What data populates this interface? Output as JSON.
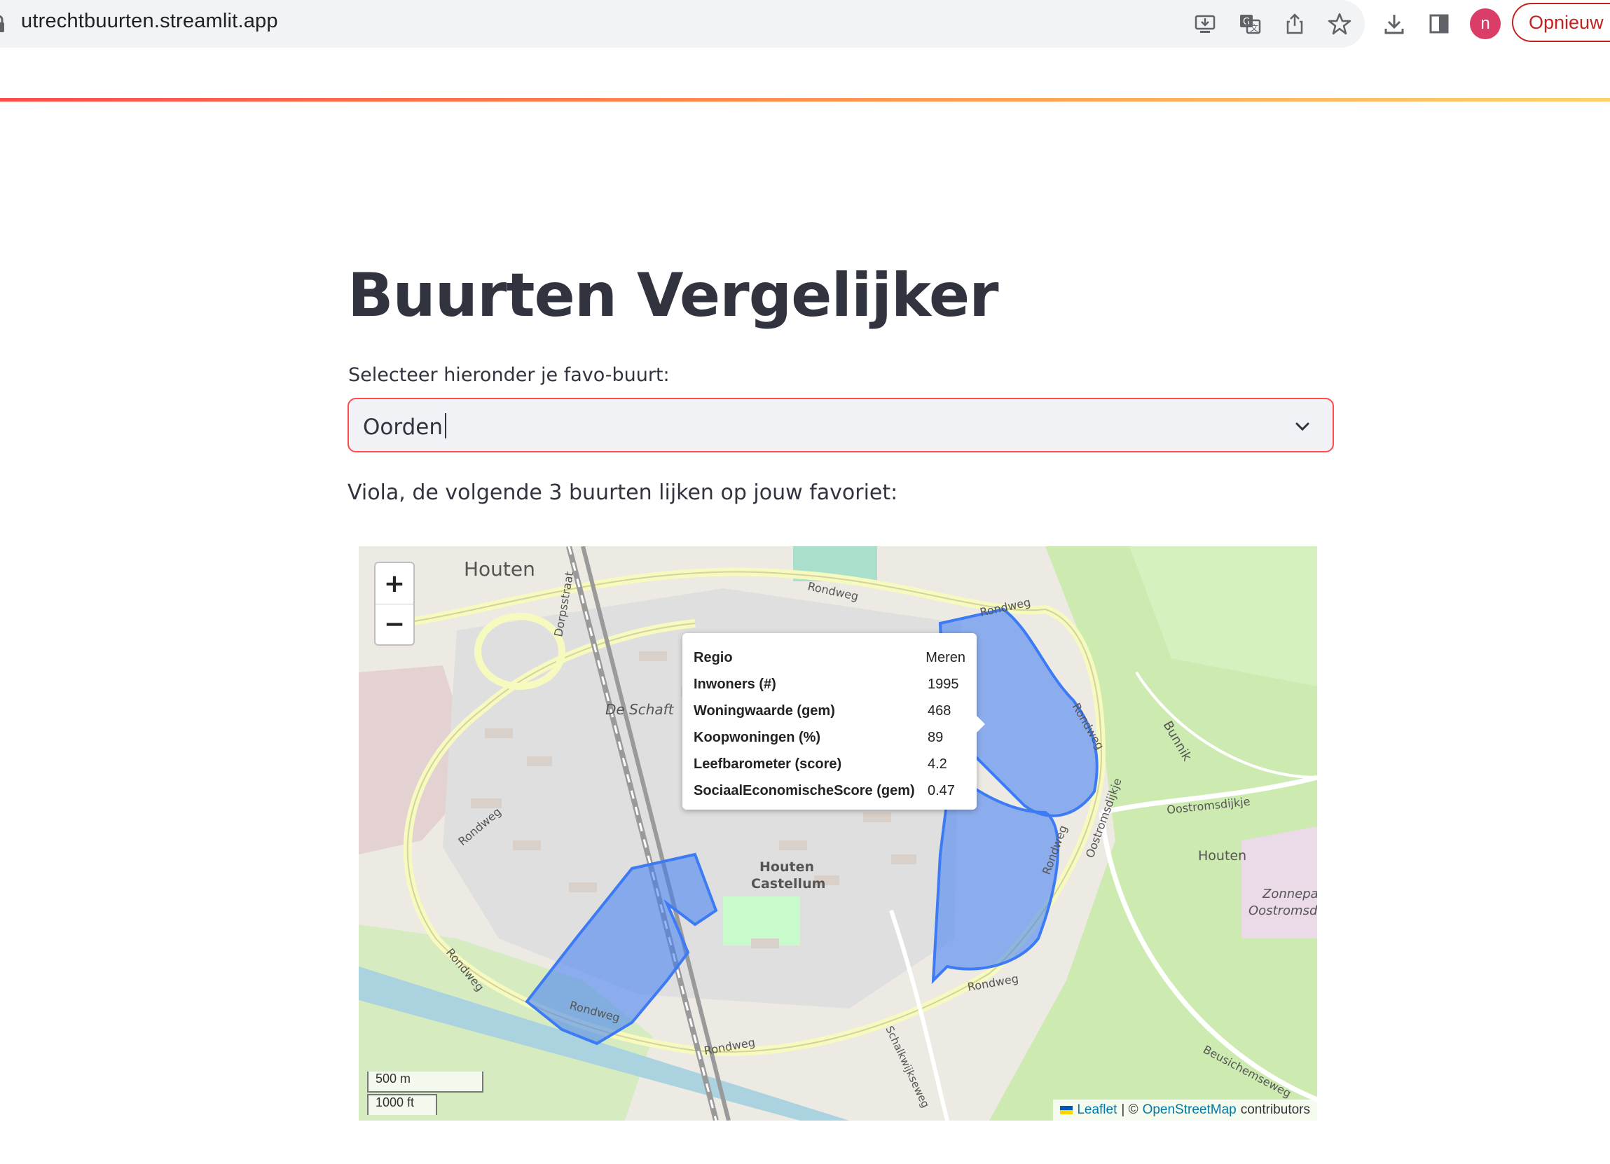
{
  "browser": {
    "url": "utrechtbuurten.streamlit.app",
    "avatar_initial": "n",
    "restart_label": "Opnieuw",
    "icons": [
      "install-app-icon",
      "translate-icon",
      "share-icon",
      "bookmark-star-icon",
      "download-icon",
      "side-panel-icon"
    ]
  },
  "app": {
    "title": "Buurten Vergelijker",
    "select_label": "Selecteer hieronder je favo-buurt:",
    "select_value": "Oorden",
    "result_text": "Viola, de volgende 3 buurten lijken op jouw favoriet:"
  },
  "map": {
    "zoom_in": "+",
    "zoom_out": "−",
    "highlight_color": "#3d7bf5",
    "place_labels": {
      "houten": "Houten",
      "de_schaft": "De Schaft",
      "castellum_1": "Houten",
      "castellum_2": "Castellum",
      "houten_east": "Houten",
      "zonnepark_1": "Zonnepa",
      "zonnepark_2": "Oostromsd",
      "bunnik": "Bunnik"
    },
    "road_labels": {
      "rondweg_top": "Rondweg",
      "rondweg_left": "Rondweg",
      "rondweg_bottom_left": "Rondweg",
      "rondweg_bottom_1": "Rondweg",
      "rondweg_bottom_2": "Rondweg",
      "rondweg_bottom_3": "Rondweg",
      "rondweg_east_1": "Rondweg",
      "rondweg_east_2": "Rondweg",
      "rondweg_east_3": "Rondweg",
      "dorpsstraat": "Dorpsstraat",
      "oostromsdijkje_1": "Oostromsdijkje",
      "oostromsdijkje_2": "Oostromsdijkje",
      "beusichemseweg": "Beusichemseweg",
      "schalkwijkseweg": "Schalkwijkseweg"
    },
    "tooltip": [
      {
        "key": "Regio",
        "value": "Meren"
      },
      {
        "key": "Inwoners (#)",
        "value": "1995"
      },
      {
        "key": "Woningwaarde (gem)",
        "value": "468"
      },
      {
        "key": "Koopwoningen (%)",
        "value": "89"
      },
      {
        "key": "Leefbarometer (score)",
        "value": "4.2"
      },
      {
        "key": "SociaalEconomischeScore (gem)",
        "value": "0.47"
      }
    ],
    "scale_metric": "500 m",
    "scale_imperial": "1000 ft",
    "attribution": {
      "leaflet": "Leaflet",
      "separator": "| ©",
      "osm": "OpenStreetMap",
      "suffix": "contributors"
    }
  }
}
